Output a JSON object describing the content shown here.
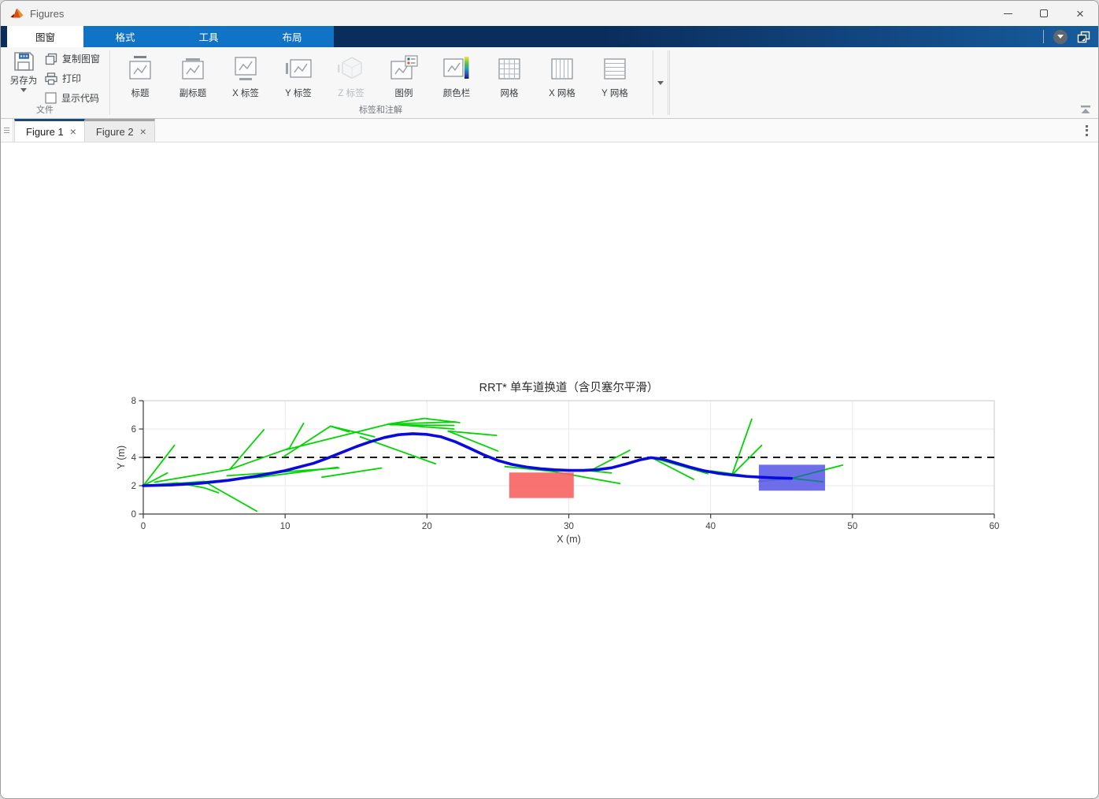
{
  "titlebar": {
    "app_title": "Figures"
  },
  "ribbon_tabs": [
    {
      "label": "图窗",
      "active": true
    },
    {
      "label": "格式",
      "active": false
    },
    {
      "label": "工具",
      "active": false
    },
    {
      "label": "布局",
      "active": false
    }
  ],
  "file_section": {
    "label": "文件",
    "save_as": "另存为",
    "copy_figure": "复制图窗",
    "print": "打印",
    "show_code": "显示代码"
  },
  "annot_section": {
    "label": "标签和注解",
    "buttons": [
      "标题",
      "副标题",
      "X 标签",
      "Y 标签",
      "Z 标签",
      "图例",
      "颜色栏",
      "网格",
      "X 网格",
      "Y 网格"
    ]
  },
  "doc_tabs": [
    {
      "label": "Figure 1",
      "close": "×",
      "active": true
    },
    {
      "label": "Figure 2",
      "close": "×",
      "active": false
    }
  ],
  "chart_data": {
    "type": "line",
    "title": "RRT* 单车道换道（含贝塞尔平滑）",
    "xlabel": "X (m)",
    "ylabel": "Y (m)",
    "xlim": [
      0,
      60
    ],
    "ylim": [
      0,
      8
    ],
    "xticks": [
      0,
      10,
      20,
      30,
      40,
      50,
      60
    ],
    "yticks": [
      0,
      2,
      4,
      6,
      8
    ],
    "grid": "on",
    "lane_line_y": 4,
    "colors": {
      "path": "#0a0ae0",
      "tree": "#00d500",
      "tree_in_obstacle": "#148278",
      "lane": "#1a1a1a",
      "grid": "#e9e9e9",
      "spine_dark": "#3c3c3c",
      "spine_light": "#c9c9c9",
      "text": "#3d3d3d"
    },
    "obstacles": [
      {
        "name": "obstacle-red",
        "x": 25.8,
        "y": 1.13,
        "w": 4.55,
        "h": 1.8,
        "color": "#f75f5f"
      },
      {
        "name": "obstacle-blue",
        "x": 43.4,
        "y": 1.65,
        "w": 4.67,
        "h": 1.83,
        "color": "#5a5ae8"
      }
    ],
    "tree_segments": [
      [
        0,
        2,
        2.2,
        4.85
      ],
      [
        0,
        2,
        1.7,
        2.9
      ],
      [
        0,
        2,
        2.4,
        2.2
      ],
      [
        0,
        2,
        4.3,
        2.3
      ],
      [
        2.4,
        2.2,
        4.3,
        1.85
      ],
      [
        4.3,
        1.85,
        5.3,
        1.5
      ],
      [
        4.3,
        2.3,
        8.0,
        0.2
      ],
      [
        0.8,
        2.25,
        6.1,
        3.15
      ],
      [
        6.1,
        3.15,
        8.5,
        5.95
      ],
      [
        6.1,
        3.15,
        10.3,
        4.65
      ],
      [
        10.3,
        4.65,
        11.3,
        6.4
      ],
      [
        2.2,
        2.1,
        8.2,
        2.6
      ],
      [
        8.2,
        2.6,
        13.7,
        3.3
      ],
      [
        5.9,
        2.7,
        13.8,
        3.25
      ],
      [
        12.6,
        2.6,
        16.8,
        3.25
      ],
      [
        9.9,
        4.05,
        13.2,
        6.2
      ],
      [
        13.2,
        6.2,
        14.5,
        5.8
      ],
      [
        13.2,
        6.2,
        16.3,
        5.45
      ],
      [
        10.1,
        4.55,
        17.3,
        6.35
      ],
      [
        17.3,
        6.35,
        19.8,
        6.75
      ],
      [
        19.8,
        6.75,
        22.3,
        6.45
      ],
      [
        17.3,
        6.35,
        22.0,
        6.5
      ],
      [
        17.3,
        6.35,
        21.9,
        6.0
      ],
      [
        17.4,
        6.3,
        21.9,
        6.25
      ],
      [
        15.3,
        5.45,
        20.6,
        3.55
      ],
      [
        21.5,
        5.85,
        24.9,
        5.55
      ],
      [
        21.5,
        5.85,
        25.0,
        4.45
      ],
      [
        25.5,
        3.35,
        28.9,
        3.0
      ],
      [
        28.9,
        3.0,
        33.6,
        2.15
      ],
      [
        31.5,
        3.05,
        34.3,
        4.5
      ],
      [
        31.5,
        3.05,
        33.0,
        2.9
      ],
      [
        35.8,
        4.0,
        38.8,
        2.45
      ],
      [
        35.8,
        4.0,
        39.8,
        2.85
      ],
      [
        35.8,
        4.0,
        41.0,
        2.75
      ],
      [
        40.0,
        3.05,
        43.3,
        2.6
      ],
      [
        41.5,
        2.75,
        42.9,
        6.7
      ],
      [
        41.5,
        2.75,
        43.6,
        4.85
      ],
      [
        43.4,
        2.3,
        45.6,
        2.5
      ]
    ],
    "tree_segments_teal": [
      [
        45.7,
        2.52,
        48.07,
        3.13
      ],
      [
        45.7,
        2.52,
        47.9,
        2.28
      ]
    ],
    "tree_segments_over": [
      [
        48.07,
        3.13,
        49.3,
        3.45
      ]
    ],
    "path": [
      [
        0,
        2
      ],
      [
        2,
        2.05
      ],
      [
        4,
        2.17
      ],
      [
        6,
        2.38
      ],
      [
        8,
        2.68
      ],
      [
        10,
        3.06
      ],
      [
        12,
        3.58
      ],
      [
        13,
        3.95
      ],
      [
        14,
        4.35
      ],
      [
        15,
        4.75
      ],
      [
        16,
        5.1
      ],
      [
        17,
        5.4
      ],
      [
        18,
        5.6
      ],
      [
        19,
        5.67
      ],
      [
        20,
        5.62
      ],
      [
        21,
        5.45
      ],
      [
        22,
        5.1
      ],
      [
        23,
        4.65
      ],
      [
        24,
        4.18
      ],
      [
        25,
        3.78
      ],
      [
        26,
        3.5
      ],
      [
        27,
        3.32
      ],
      [
        28,
        3.2
      ],
      [
        29,
        3.12
      ],
      [
        30,
        3.08
      ],
      [
        31,
        3.08
      ],
      [
        32,
        3.13
      ],
      [
        33,
        3.26
      ],
      [
        34,
        3.52
      ],
      [
        35,
        3.82
      ],
      [
        35.8,
        3.98
      ],
      [
        36.6,
        3.88
      ],
      [
        37.5,
        3.62
      ],
      [
        38.5,
        3.32
      ],
      [
        39.5,
        3.06
      ],
      [
        40.5,
        2.88
      ],
      [
        41.5,
        2.76
      ],
      [
        42.5,
        2.66
      ],
      [
        43.5,
        2.6
      ],
      [
        44.5,
        2.55
      ],
      [
        45.7,
        2.52
      ]
    ]
  }
}
